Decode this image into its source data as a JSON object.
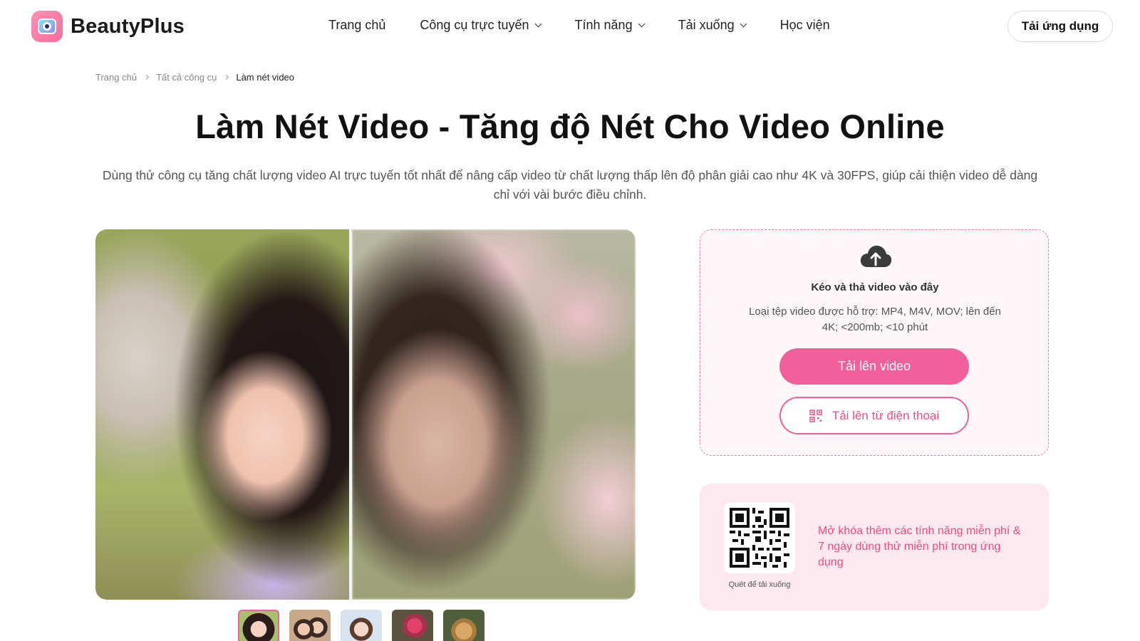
{
  "brand": {
    "name": "BeautyPlus",
    "accent": "#f0609a"
  },
  "nav": {
    "items": [
      {
        "label": "Trang chủ",
        "dropdown": false
      },
      {
        "label": "Công cụ trực tuyến",
        "dropdown": true
      },
      {
        "label": "Tính năng",
        "dropdown": true
      },
      {
        "label": "Tải xuống",
        "dropdown": true
      },
      {
        "label": "Học viện",
        "dropdown": false
      }
    ],
    "app_button": "Tải ứng dụng"
  },
  "breadcrumb": [
    "Trang chủ",
    "Tất cả công cụ",
    "Làm nét video"
  ],
  "page": {
    "title": "Làm Nét Video - Tăng độ Nét Cho Video Online",
    "description": "Dùng thử công cụ tăng chất lượng video AI trực tuyến tốt nhất để nâng cấp video từ chất lượng thấp lên độ phân giải cao như 4K và 30FPS, giúp cải thiện video dễ dàng chỉ với vài bước điều chỉnh."
  },
  "preview": {
    "thumbnails": [
      "portrait-girl",
      "two-women",
      "child",
      "flowers",
      "dog"
    ],
    "active_thumbnail": 0
  },
  "upload": {
    "icon": "cloud-upload-icon",
    "title": "Kéo và thả video vào đây",
    "hint": "Loại tệp video được hỗ trợ: MP4, M4V, MOV; lên đến 4K; <200mb; <10 phút",
    "upload_button": "Tải lên video",
    "phone_button": "Tải lên từ điện thoại"
  },
  "promo": {
    "qr_caption": "Quét để tải xuống",
    "text": "Mở khóa thêm các tính năng miễn phí & 7 ngày dùng thử miễn phí trong ứng dụng"
  }
}
